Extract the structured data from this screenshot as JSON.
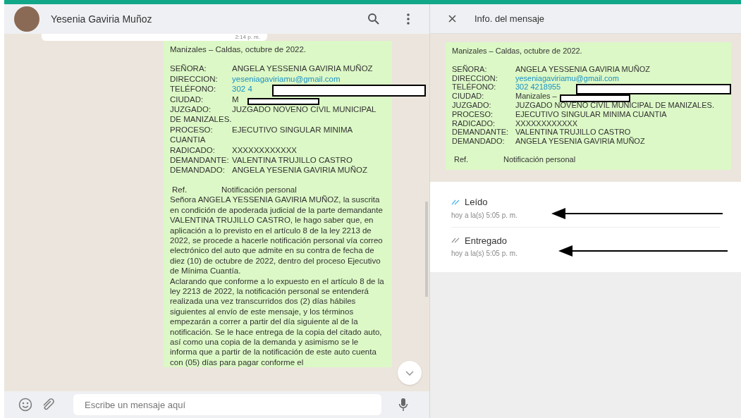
{
  "chat": {
    "contact_name": "Yesenia Gaviria Muñoz",
    "previous_message": {
      "time": "2:14 p. m."
    },
    "message": {
      "heading": "Manizales – Caldas, octubre de 2022.",
      "fields": [
        {
          "label": "SEÑORA:",
          "value": "ANGELA YESSENIA GAVIRIA MUÑOZ",
          "kind": "text",
          "redacted": false
        },
        {
          "label": "DIRECCION:",
          "value": "yeseniagaviriamu@gmail.com",
          "kind": "link",
          "redacted": false
        },
        {
          "label": "TELÉFONO:",
          "value": "302 4",
          "kind": "link",
          "redacted": true
        },
        {
          "label": "CIUDAD:",
          "value": "M",
          "kind": "text",
          "redacted": true
        },
        {
          "label": "JUZGADO:",
          "value": "JUZGADO NOVENO CIVIL MUNICIPAL DE MANIZALES.",
          "kind": "text",
          "redacted": false
        },
        {
          "label": "PROCESO:",
          "value": "EJECUTIVO SINGULAR MINIMA CUANTIA",
          "kind": "text",
          "redacted": false
        },
        {
          "label": "RADICADO:",
          "value": "XXXXXXXXXXXX",
          "kind": "text",
          "redacted": false
        },
        {
          "label": "DEMANDANTE:",
          "value": "VALENTINA TRUJILLO CASTRO",
          "kind": "text",
          "redacted": false
        },
        {
          "label": "DEMANDADO:",
          "value": "ANGELA YESENIA GAVIRIA MUÑOZ",
          "kind": "text",
          "redacted": false
        }
      ],
      "reference": {
        "label": "Ref.",
        "value": "Notificación personal"
      },
      "paragraphs": [
        "Señora ANGELA YESSENIA GAVIRIA MUÑOZ, la suscrita en condición de apoderada judicial de la parte demandante VALENTINA TRUJILLO CASTRO, le hago saber que, en aplicación a lo previsto en el artículo 8 de la ley 2213 de 2022, se procede a hacerle notificación personal vía correo electrónico del auto que admite en su contra de fecha de diez (10) de octubre de 2022, dentro del proceso Ejecutivo de Mínima Cuantía.",
        "Aclarando que conforme a lo expuesto en el artículo 8 de la ley 2213 de 2022, la notificación personal se entenderá realizada una vez transcurridos dos (2) días hábiles siguientes al envío de este mensaje, y los términos empezarán a correr a partir del día siguiente al de la notificación. Se le hace entrega de la copia del citado auto, así como una copia de la demanda y asimismo se le informa que a partir de la notificación de este auto cuenta con (05) días para pagar conforme el"
      ]
    },
    "composer": {
      "placeholder": "Escribe un mensaje aquí"
    }
  },
  "info_panel": {
    "title": "Info. del mensaje",
    "message": {
      "heading": "Manizales – Caldas, octubre de 2022.",
      "fields": [
        {
          "label": "SEÑORA:",
          "value": "ANGELA YESSENIA GAVIRIA MUÑOZ",
          "kind": "text",
          "redacted": false
        },
        {
          "label": "DIRECCION:",
          "value": "yeseniagaviriamu@gmail.com",
          "kind": "link",
          "redacted": false
        },
        {
          "label": "TELÉFONO:",
          "value": "302 4218955",
          "kind": "link",
          "redacted": true
        },
        {
          "label": "CIUDAD:",
          "value": "Manizales –",
          "kind": "text",
          "redacted": true
        },
        {
          "label": "JUZGADO:",
          "value": "JUZGADO NOVENO CIVIL MUNICIPAL DE MANIZALES.",
          "kind": "text",
          "redacted": false
        },
        {
          "label": "PROCESO:",
          "value": "EJECUTIVO SINGULAR MINIMA CUANTIA",
          "kind": "text",
          "redacted": false
        },
        {
          "label": "RADICADO:",
          "value": "XXXXXXXXXXXX",
          "kind": "text",
          "redacted": false
        },
        {
          "label": "DEMANDANTE:",
          "value": "VALENTINA TRUJILLO CASTRO",
          "kind": "text",
          "redacted": false
        },
        {
          "label": "DEMANDADO:",
          "value": "ANGELA YESENIA GAVIRIA MUÑOZ",
          "kind": "text",
          "redacted": false
        }
      ],
      "reference": {
        "label": "Ref.",
        "value": "Notificación personal"
      }
    },
    "receipts": [
      {
        "label": "Leído",
        "time": "hoy a la(s) 5:05 p. m.",
        "read": true
      },
      {
        "label": "Entregado",
        "time": "hoy a la(s) 5:05 p. m.",
        "read": false
      }
    ]
  }
}
